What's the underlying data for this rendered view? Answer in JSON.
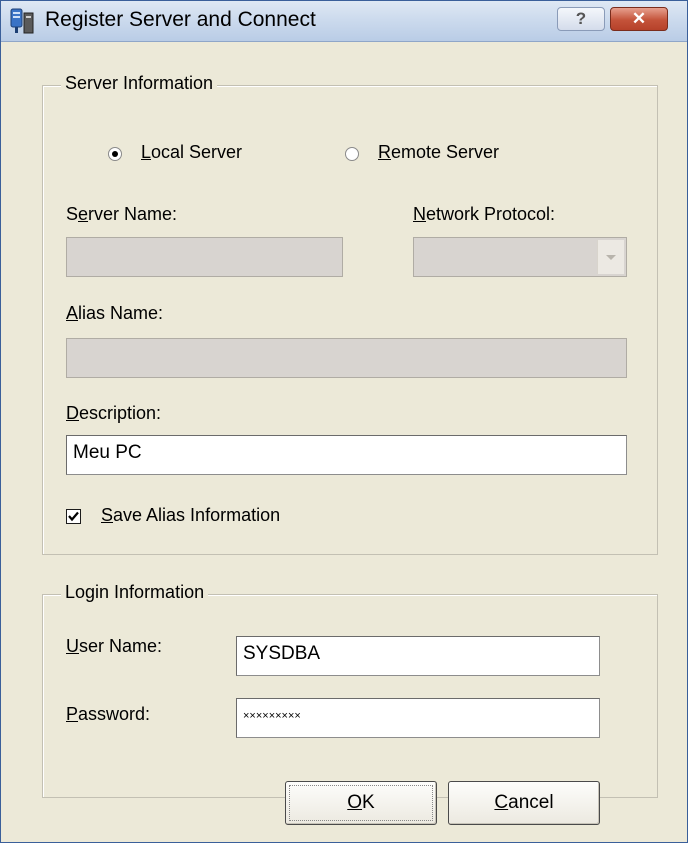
{
  "window": {
    "title": "Register Server and Connect"
  },
  "titlebar_buttons": {
    "help_label": "?",
    "close_label": "✕"
  },
  "server_group": {
    "title": "Server Information",
    "local_radio": {
      "label_accel": "L",
      "label_rest": "ocal Server",
      "checked": true
    },
    "remote_radio": {
      "label_accel": "R",
      "label_rest": "emote Server",
      "checked": false
    },
    "server_name": {
      "label_pre": "S",
      "label_accel": "e",
      "label_rest": "rver Name:",
      "value": ""
    },
    "network_protocol": {
      "label_accel": "N",
      "label_rest": "etwork Protocol:",
      "value": ""
    },
    "alias_name": {
      "label_accel": "A",
      "label_rest": "lias Name:",
      "value": ""
    },
    "description": {
      "label_accel": "D",
      "label_rest": "escription:",
      "value": "Meu PC"
    },
    "save_alias": {
      "label_accel": "S",
      "label_rest": "ave Alias Information",
      "checked": true
    }
  },
  "login_group": {
    "title": "Login Information",
    "user_name": {
      "label_accel": "U",
      "label_rest": "ser Name:",
      "value": "SYSDBA"
    },
    "password": {
      "label_accel": "P",
      "label_rest": "assword:",
      "value": "×××××××××"
    }
  },
  "buttons": {
    "ok": {
      "label_accel": "O",
      "label_rest": "K"
    },
    "cancel": {
      "label_accel": "C",
      "label_rest": "ancel"
    }
  },
  "colors": {
    "face": "#ece9d8",
    "titlebar": "#c9d8ec",
    "close": "#c4533a",
    "disabled_field": "#d8d4d0"
  },
  "icons": {
    "app": "server-registration-icon",
    "help": "help-icon",
    "close": "close-icon"
  }
}
